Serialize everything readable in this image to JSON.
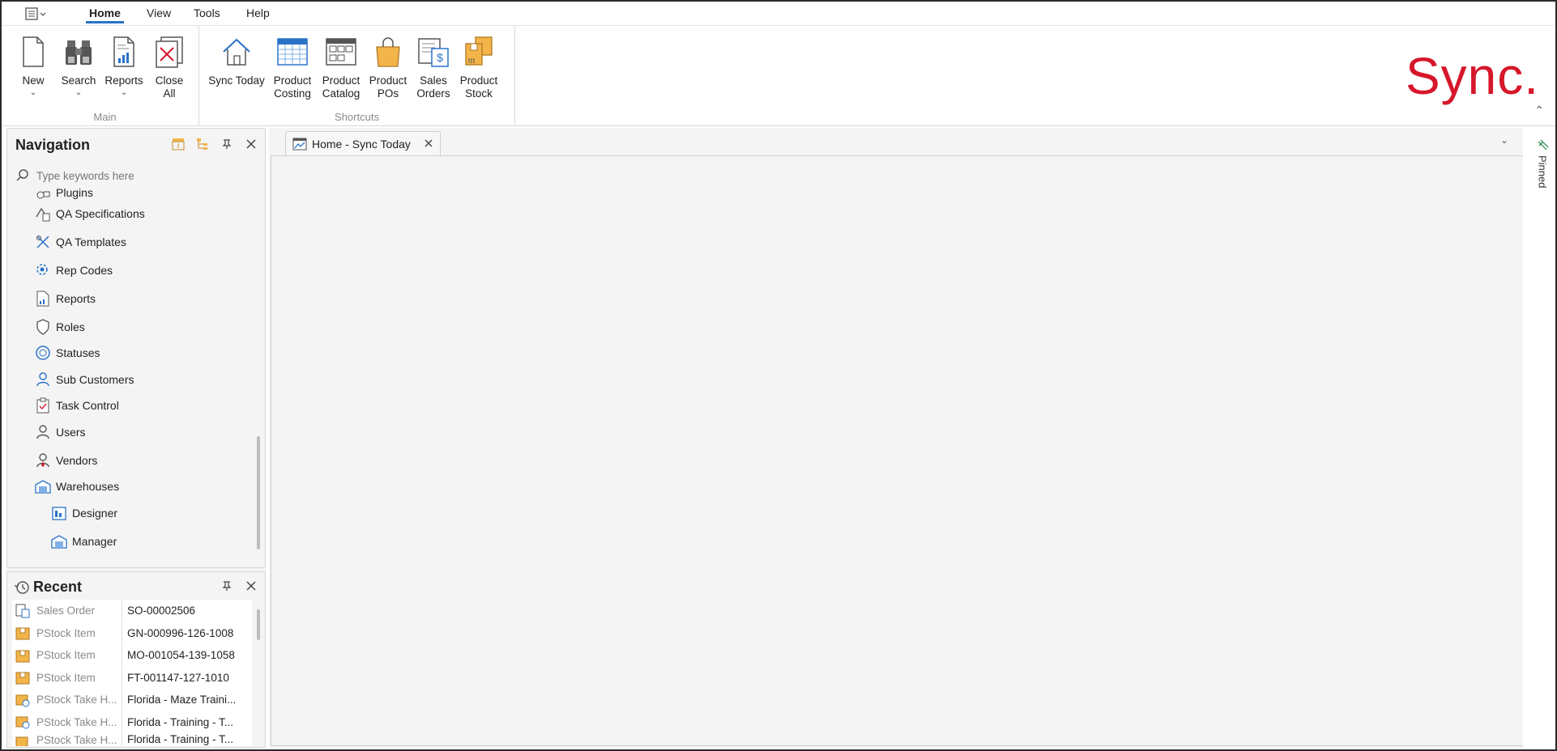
{
  "menu": {
    "tabs": [
      "Home",
      "View",
      "Tools",
      "Help"
    ],
    "active_tab": "Home"
  },
  "ribbon": {
    "groups": {
      "main": {
        "label": "Main",
        "buttons": [
          {
            "l1": "New",
            "l2": "",
            "icon": "new-document-icon",
            "dropdown": true
          },
          {
            "l1": "Search",
            "l2": "",
            "icon": "binoculars-icon",
            "dropdown": true
          },
          {
            "l1": "Reports",
            "l2": "",
            "icon": "report-icon",
            "dropdown": true
          },
          {
            "l1": "Close",
            "l2": "All",
            "icon": "close-all-icon",
            "dropdown": false
          }
        ]
      },
      "shortcuts": {
        "label": "Shortcuts",
        "buttons": [
          {
            "l1": "Sync Today",
            "l2": "",
            "icon": "home-icon"
          },
          {
            "l1": "Product",
            "l2": "Costing",
            "icon": "spreadsheet-icon"
          },
          {
            "l1": "Product",
            "l2": "Catalog",
            "icon": "catalog-icon"
          },
          {
            "l1": "Product",
            "l2": "POs",
            "icon": "shopping-bag-icon"
          },
          {
            "l1": "Sales",
            "l2": "Orders",
            "icon": "sales-order-icon"
          },
          {
            "l1": "Product",
            "l2": "Stock",
            "icon": "boxes-icon"
          }
        ]
      }
    },
    "brand": "Sync.",
    "brand_color": "#d6172b",
    "accent_color": "#2a72c8"
  },
  "navigation": {
    "title": "Navigation",
    "search_placeholder": "Type keywords here",
    "partial_top_item": "Plugins",
    "items": [
      {
        "label": "QA Specifications",
        "icon": "qa-spec-icon"
      },
      {
        "label": "QA Templates",
        "icon": "qa-template-icon"
      },
      {
        "label": "Rep Codes",
        "icon": "rep-codes-icon"
      },
      {
        "label": "Reports",
        "icon": "report-icon"
      },
      {
        "label": "Roles",
        "icon": "shield-icon"
      },
      {
        "label": "Statuses",
        "icon": "status-icon"
      },
      {
        "label": "Sub Customers",
        "icon": "customer-icon"
      },
      {
        "label": "Task Control",
        "icon": "clipboard-icon"
      },
      {
        "label": "Users",
        "icon": "user-icon"
      },
      {
        "label": "Vendors",
        "icon": "vendor-icon"
      },
      {
        "label": "Warehouses",
        "icon": "warehouse-icon"
      }
    ],
    "sub_items": [
      {
        "label": "Designer",
        "icon": "designer-icon"
      },
      {
        "label": "Manager",
        "icon": "warehouse-icon"
      }
    ]
  },
  "recent": {
    "title": "Recent",
    "rows": [
      {
        "type": "Sales Order",
        "value": "SO-00002506",
        "icon": "sales-order-icon"
      },
      {
        "type": "PStock Item",
        "value": "GN-000996-126-1008",
        "icon": "stock-item-icon"
      },
      {
        "type": "PStock Item",
        "value": "MO-001054-139-1058",
        "icon": "stock-item-icon"
      },
      {
        "type": "PStock Item",
        "value": "FT-001147-127-1010",
        "icon": "stock-item-icon"
      },
      {
        "type": "PStock Take H...",
        "value": "Florida - Maze Traini...",
        "icon": "stock-take-icon"
      },
      {
        "type": "PStock Take H...",
        "value": "Florida - Training - T...",
        "icon": "stock-take-icon"
      },
      {
        "type": "PStock Take H...",
        "value": "Florida - Training - T...",
        "icon": "stock-take-icon"
      }
    ]
  },
  "document": {
    "tab_label": "Home - Sync Today"
  },
  "rail": {
    "pinned_label": "Pinned"
  }
}
